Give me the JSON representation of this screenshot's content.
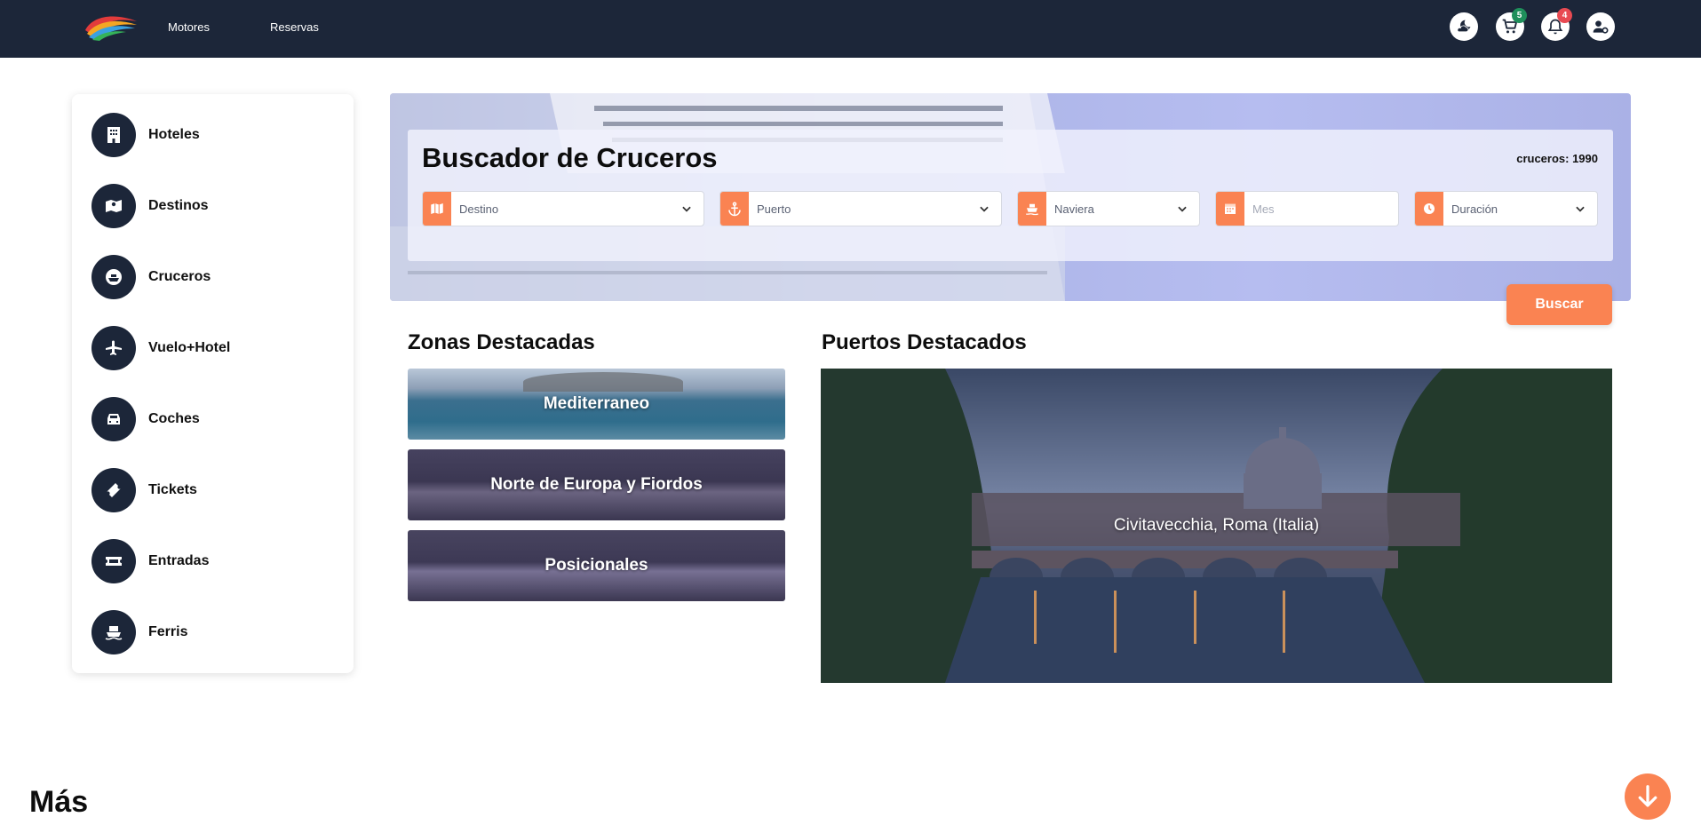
{
  "topbar": {
    "nav": [
      {
        "label": "Motores"
      },
      {
        "label": "Reservas"
      }
    ],
    "icons": {
      "theme": "moon-cloud-icon",
      "cart": "cart-icon",
      "cart_badge": "5",
      "notifications": "bell-icon",
      "notifications_badge": "4",
      "user": "user-gear-icon"
    },
    "colors": {
      "bar": "#1c2639",
      "cart_badge": "#1e8f5b",
      "notif_badge": "#e84a52"
    }
  },
  "sidebar": {
    "items": [
      {
        "label": "Hoteles",
        "icon": "building-icon"
      },
      {
        "label": "Destinos",
        "icon": "map-pin-icon"
      },
      {
        "label": "Cruceros",
        "icon": "ship-icon"
      },
      {
        "label": "Vuelo+Hotel",
        "icon": "plane-icon"
      },
      {
        "label": "Coches",
        "icon": "car-icon"
      },
      {
        "label": "Tickets",
        "icon": "ticket-icon"
      },
      {
        "label": "Entradas",
        "icon": "admission-ticket-icon"
      },
      {
        "label": "Ferris",
        "icon": "ferry-icon"
      }
    ]
  },
  "search": {
    "title": "Buscador de Cruceros",
    "count": "cruceros: 1990",
    "fields": {
      "destino": {
        "value": "Destino",
        "icon": "map-icon"
      },
      "puerto": {
        "value": "Puerto",
        "icon": "anchor-icon"
      },
      "naviera": {
        "value": "Naviera",
        "icon": "ship-icon"
      },
      "mes": {
        "placeholder": "Mes",
        "icon": "calendar-icon"
      },
      "duracion": {
        "value": "Duración",
        "icon": "clock-icon"
      }
    },
    "button": "Buscar",
    "accent": "#fa8352"
  },
  "zonas": {
    "title": "Zonas Destacadas",
    "items": [
      {
        "label": "Mediterraneo"
      },
      {
        "label": "Norte de Europa y Fiordos"
      },
      {
        "label": "Posicionales"
      }
    ]
  },
  "puertos": {
    "title": "Puertos Destacados",
    "items": [
      {
        "label": "Civitavecchia, Roma (Italia)"
      }
    ]
  },
  "footer": {
    "more_title": "Más",
    "scroll_icon": "arrow-down-icon"
  }
}
